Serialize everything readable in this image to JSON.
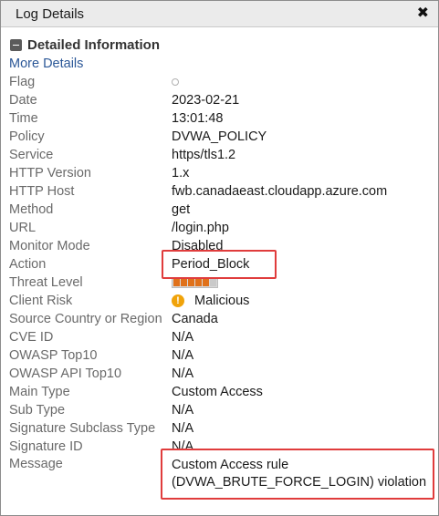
{
  "window": {
    "title": "Log Details"
  },
  "section": {
    "title": "Detailed Information"
  },
  "more_details": "More Details",
  "rows": {
    "flag": {
      "label": "Flag",
      "value": ""
    },
    "date": {
      "label": "Date",
      "value": "2023-02-21"
    },
    "time": {
      "label": "Time",
      "value": "13:01:48"
    },
    "policy": {
      "label": "Policy",
      "value": "DVWA_POLICY"
    },
    "service": {
      "label": "Service",
      "value": "https/tls1.2"
    },
    "http_version": {
      "label": "HTTP Version",
      "value": "1.x"
    },
    "http_host": {
      "label": "HTTP Host",
      "value": "fwb.canadaeast.cloudapp.azure.com"
    },
    "method": {
      "label": "Method",
      "value": "get"
    },
    "url": {
      "label": "URL",
      "value": "/login.php"
    },
    "monitor_mode": {
      "label": "Monitor Mode",
      "value": "Disabled"
    },
    "action": {
      "label": "Action",
      "value": "Period_Block"
    },
    "threat_level": {
      "label": "Threat Level",
      "level": 5,
      "max": 6
    },
    "client_risk": {
      "label": "Client Risk",
      "value": "Malicious"
    },
    "source_country": {
      "label": "Source Country or Region",
      "value": "Canada"
    },
    "cve_id": {
      "label": "CVE ID",
      "value": "N/A"
    },
    "owasp_top10": {
      "label": "OWASP Top10",
      "value": "N/A"
    },
    "owasp_api_top10": {
      "label": "OWASP API Top10",
      "value": "N/A"
    },
    "main_type": {
      "label": "Main Type",
      "value": "Custom Access"
    },
    "sub_type": {
      "label": "Sub Type",
      "value": "N/A"
    },
    "signature_subclass_type": {
      "label": "Signature Subclass Type",
      "value": "N/A"
    },
    "signature_id": {
      "label": "Signature ID",
      "value": "N/A"
    },
    "message": {
      "label": "Message",
      "value_line1": "Custom Access rule",
      "value_line2": "(DVWA_BRUTE_FORCE_LOGIN) violation"
    }
  },
  "colors": {
    "highlight": "#e03c3c",
    "link": "#2b5797",
    "threat": "#e0711a",
    "warning": "#f0a30a"
  }
}
